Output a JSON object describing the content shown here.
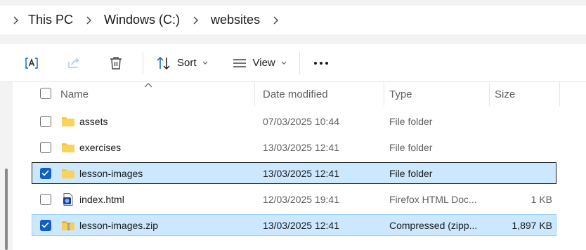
{
  "breadcrumb": {
    "items": [
      "This PC",
      "Windows (C:)",
      "websites"
    ]
  },
  "toolbar": {
    "sort_label": "Sort",
    "view_label": "View"
  },
  "columns": {
    "name": "Name",
    "date": "Date modified",
    "type": "Type",
    "size": "Size"
  },
  "files": [
    {
      "name": "assets",
      "date": "07/03/2025 10:44",
      "type": "File folder",
      "size": "",
      "icon": "folder-icon",
      "checked": false
    },
    {
      "name": "exercises",
      "date": "13/03/2025 12:41",
      "type": "File folder",
      "size": "",
      "icon": "folder-icon",
      "checked": false
    },
    {
      "name": "lesson-images",
      "date": "13/03/2025 12:41",
      "type": "File folder",
      "size": "",
      "icon": "folder-icon",
      "checked": true
    },
    {
      "name": "index.html",
      "date": "12/03/2025 19:41",
      "type": "Firefox HTML Doc...",
      "size": "1 KB",
      "icon": "html-file-icon",
      "checked": false
    },
    {
      "name": "lesson-images.zip",
      "date": "13/03/2025 12:41",
      "type": "Compressed (zipp...",
      "size": "1,897 KB",
      "icon": "zip-folder-icon",
      "checked": true
    }
  ],
  "colors": {
    "selection_bg": "#cce8ff",
    "checkbox_checked": "#0f5fc6",
    "folder_yellow": "#f8c740"
  }
}
